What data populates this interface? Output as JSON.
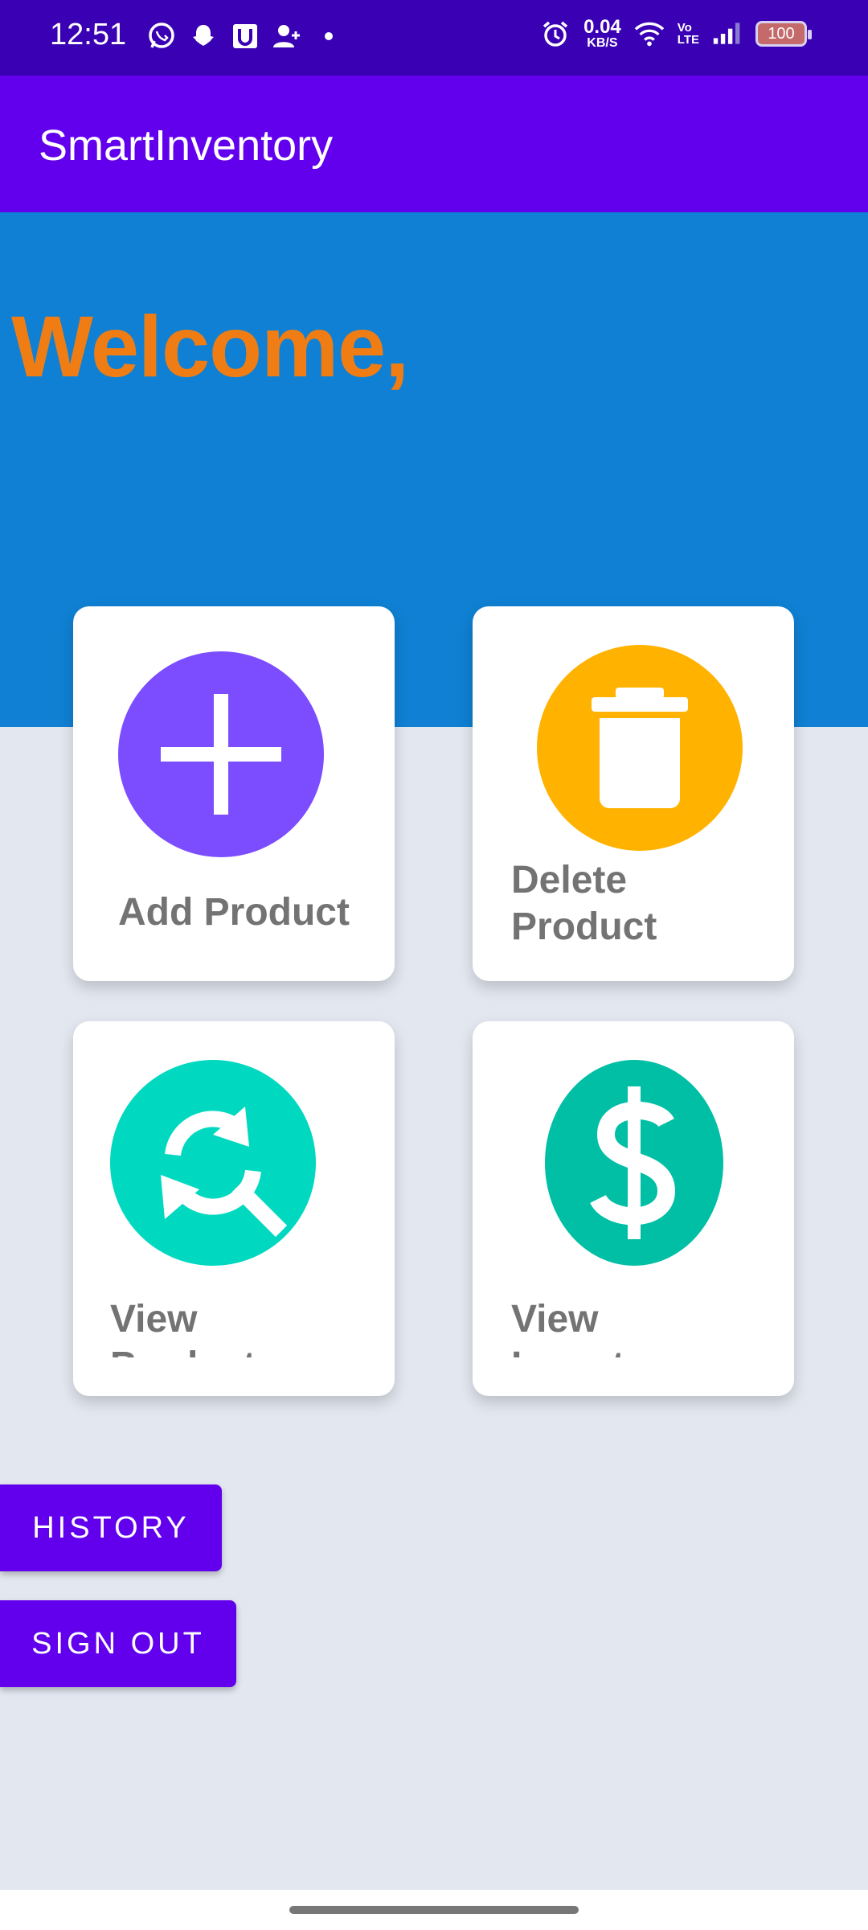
{
  "status_bar": {
    "time": "12:51",
    "net_speed_value": "0.04",
    "net_speed_unit": "KB/S",
    "volte_top": "Vo",
    "volte_bottom": "LTE",
    "battery": "100",
    "left_icons": [
      "whatsapp-icon",
      "snapchat-icon",
      "u-app-icon",
      "add-person-icon",
      "dot-icon"
    ],
    "right_icons": [
      "alarm-icon",
      "wifi-icon",
      "signal-icon",
      "battery-icon"
    ]
  },
  "app_bar": {
    "title": "SmartInventory"
  },
  "hero": {
    "welcome": "Welcome,"
  },
  "cards": [
    {
      "label": "Add Product",
      "icon": "plus-icon",
      "color": "#7c4dff"
    },
    {
      "label": "Delete Product",
      "icon": "trash-icon",
      "color": "#ffb300"
    },
    {
      "label": "View Product",
      "icon": "refresh-search-icon",
      "color": "#00d9c0"
    },
    {
      "label": "View Inventory",
      "icon": "dollar-icon",
      "color": "#00bfa5"
    }
  ],
  "buttons": {
    "history": "HISTORY",
    "sign_out": "SIGN OUT"
  },
  "colors": {
    "primary": "#6200ee",
    "status_bar": "#3a00b4",
    "hero": "#0f80d3",
    "welcome": "#f07d14",
    "background": "#e3e7f0"
  }
}
